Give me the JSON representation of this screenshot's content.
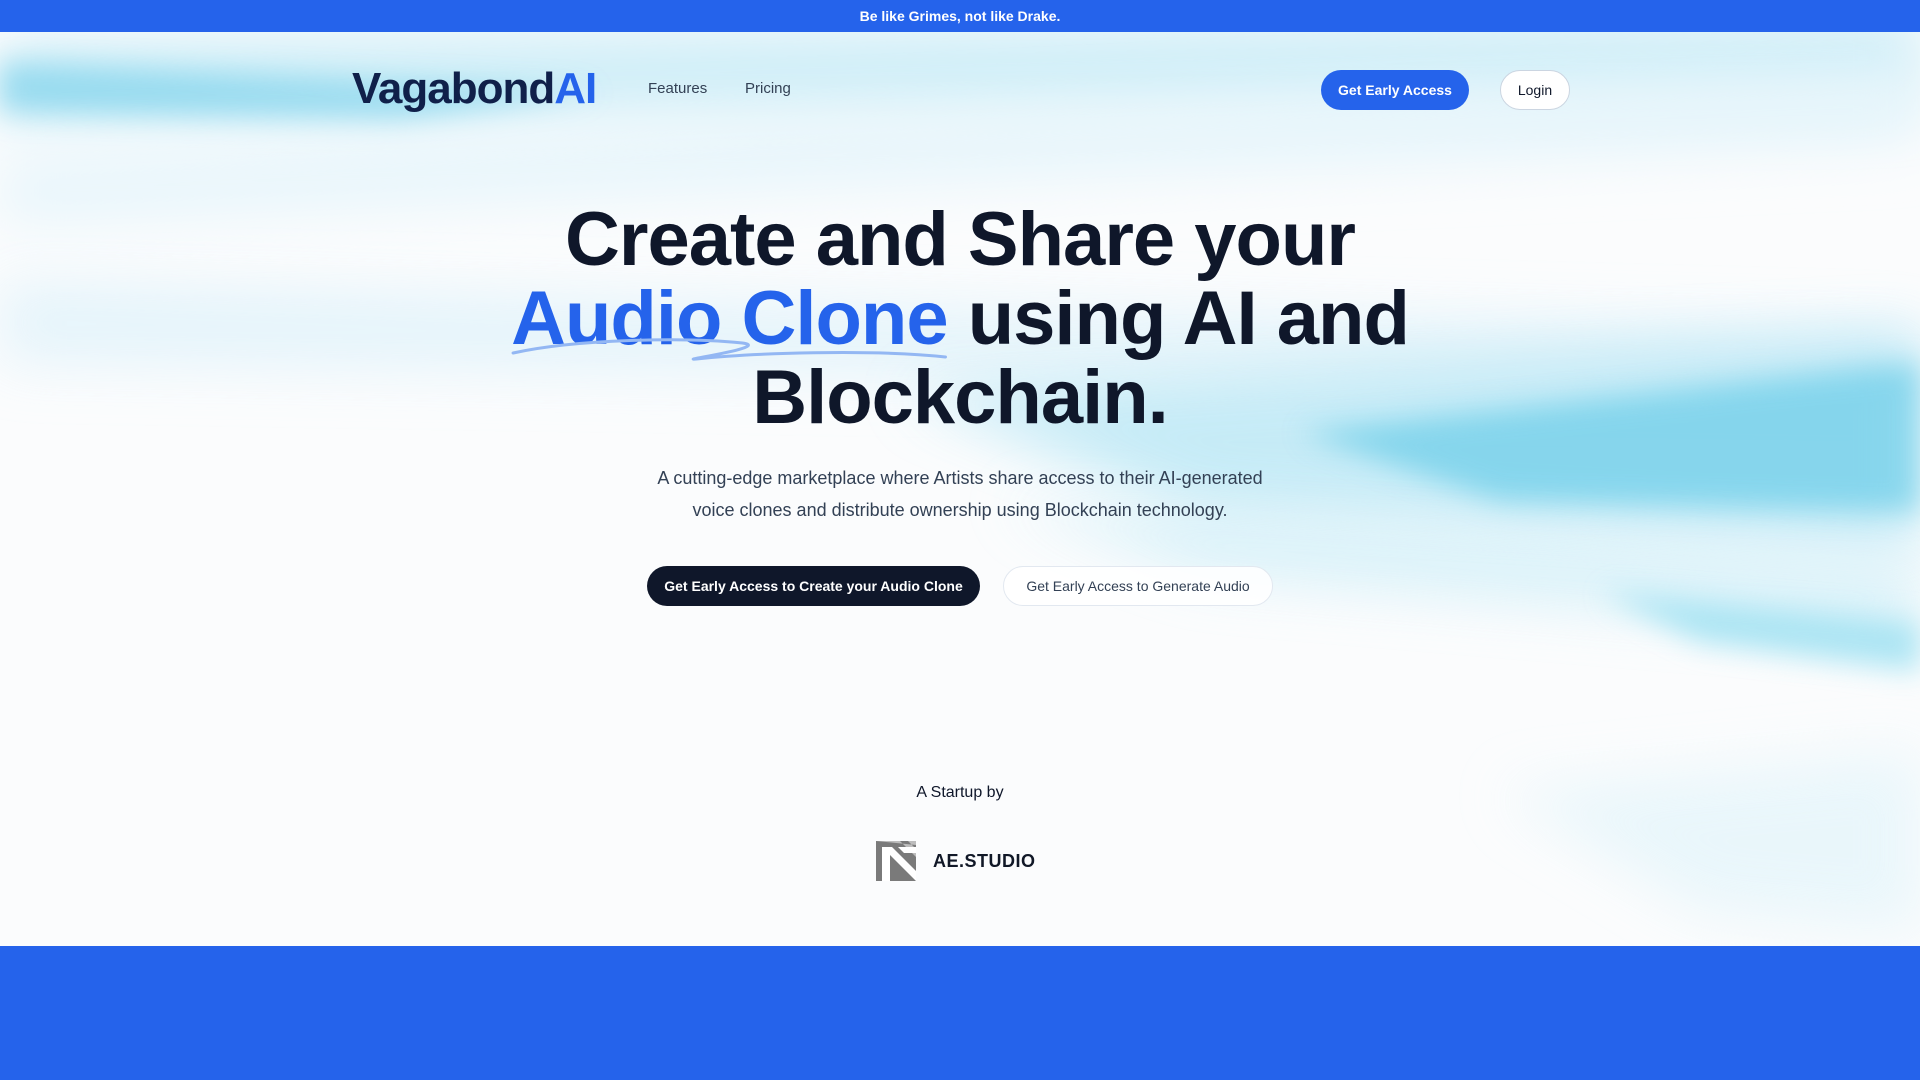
{
  "announcement": "Be like Grimes, not like Drake.",
  "nav": {
    "logo_main": "Vagabond",
    "logo_accent": "AI",
    "links": [
      "Features",
      "Pricing"
    ],
    "cta_label": "Get Early Access",
    "login_label": "Login"
  },
  "hero": {
    "headline_line1": "Create and Share your",
    "headline_highlight": "Audio Clone",
    "headline_line2_rest": " using AI and",
    "headline_line3": "Blockchain.",
    "subtitle_line1": "A cutting-edge marketplace where Artists share access to their AI-generated",
    "subtitle_line2": "voice clones and distribute ownership using Blockchain technology.",
    "cta_primary": "Get Early Access to Create your Audio Clone",
    "cta_secondary": "Get Early Access to Generate Audio"
  },
  "startup": {
    "label": "A Startup by",
    "company": "AE.STUDIO"
  },
  "colors": {
    "accent": "#2563eb",
    "dark": "#0f172a",
    "announcement_bg": "#2563eb"
  }
}
